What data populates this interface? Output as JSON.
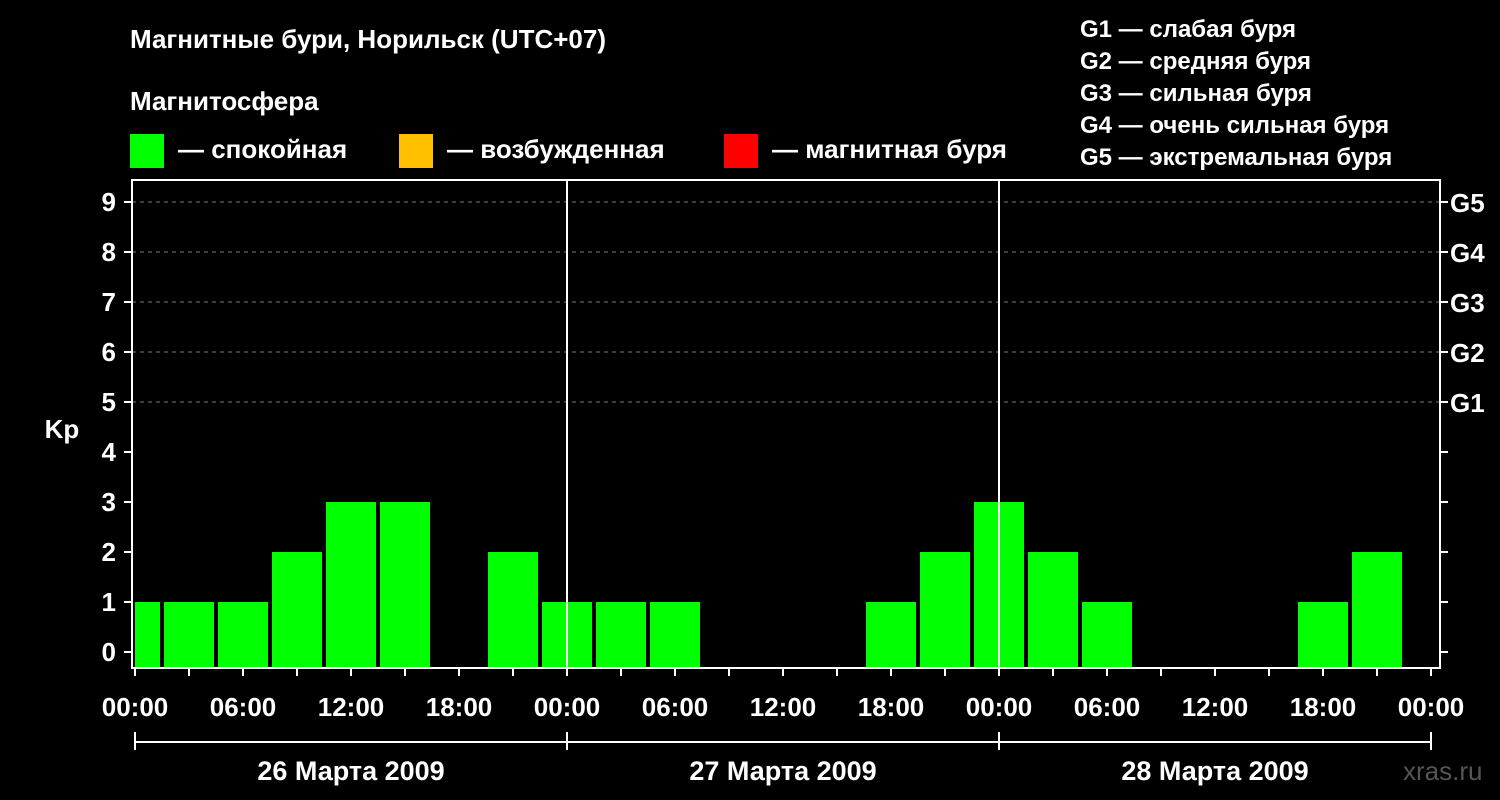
{
  "title": "Магнитные бури, Норильск (UTC+07)",
  "subtitle": "Магнитосфера",
  "legend": [
    {
      "label": "— спокойная",
      "color": "#00ff00"
    },
    {
      "label": "— возбужденная",
      "color": "#ffc000"
    },
    {
      "label": "— магнитная буря",
      "color": "#ff0000"
    }
  ],
  "storm_levels": [
    "G1 — слабая буря",
    "G2 — средняя буря",
    "G3 — сильная буря",
    "G4 — очень сильная буря",
    "G5 — экстремальная буря"
  ],
  "credit": "xras.ru",
  "chart_data": {
    "type": "bar",
    "title": "Магнитные бури, Норильск (UTC+07)",
    "ylabel": "Kp",
    "ylim": [
      0,
      9
    ],
    "grid": "dashed horizontal at Kp 5–9",
    "yticks": [
      "0",
      "1",
      "2",
      "3",
      "4",
      "5",
      "6",
      "7",
      "8",
      "9"
    ],
    "right_ticks": [
      {
        "kp": 5,
        "label": "G1"
      },
      {
        "kp": 6,
        "label": "G2"
      },
      {
        "kp": 7,
        "label": "G3"
      },
      {
        "kp": 8,
        "label": "G4"
      },
      {
        "kp": 9,
        "label": "G5"
      }
    ],
    "xtick_labels": [
      "00:00",
      "06:00",
      "12:00",
      "18:00",
      "00:00",
      "06:00",
      "12:00",
      "18:00",
      "00:00",
      "06:00",
      "12:00",
      "18:00",
      "00:00"
    ],
    "days": [
      "26 Марта 2009",
      "27 Марта 2009",
      "28 Марта 2009"
    ],
    "interval_hours": 3,
    "series": [
      {
        "values": [
          1,
          1,
          1,
          2,
          3,
          3,
          0,
          2,
          1,
          1,
          1,
          0,
          0,
          0,
          1,
          2,
          3,
          2,
          1,
          0,
          0,
          0,
          1,
          2
        ]
      }
    ],
    "colors": {
      "quiet": "#00ff00",
      "active": "#ffc000",
      "storm": "#ff0000"
    },
    "first_bar_note": "first 3-h bar starts before 00:00 and is clipped"
  }
}
